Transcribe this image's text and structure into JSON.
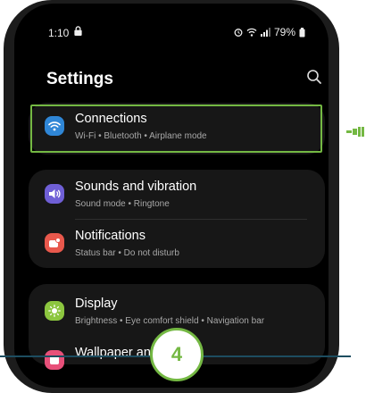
{
  "status_bar": {
    "time": "1:10",
    "battery": "79%"
  },
  "header": {
    "title": "Settings"
  },
  "settings": {
    "connections": {
      "title": "Connections",
      "subtitle": "Wi-Fi  •  Bluetooth  •  Airplane mode"
    },
    "sounds": {
      "title": "Sounds and vibration",
      "subtitle": "Sound mode  •  Ringtone"
    },
    "notifications": {
      "title": "Notifications",
      "subtitle": "Status bar  •  Do not disturb"
    },
    "display": {
      "title": "Display",
      "subtitle": "Brightness  •  Eye comfort shield  •  Navigation bar"
    },
    "wallpaper": {
      "title": "Wallpaper and"
    }
  },
  "overlay": {
    "step_number": "4"
  },
  "colors": {
    "highlight": "#74b843",
    "connections_icon": "#2f86d6",
    "sounds_icon": "#6f5fd6",
    "notifications_icon": "#e8584c",
    "display_icon": "#8cc63f",
    "wallpaper_icon": "#e8507a"
  },
  "icons": {
    "status_left": "lock-icon",
    "status_right": [
      "alarm-icon",
      "wifi-icon",
      "signal-icon",
      "battery-icon"
    ],
    "header": "search-icon",
    "settings": [
      "wifi-icon",
      "speaker-icon",
      "notification-icon",
      "brightness-icon",
      "wallpaper-icon"
    ],
    "annotation": "pointing-hand-icon"
  }
}
